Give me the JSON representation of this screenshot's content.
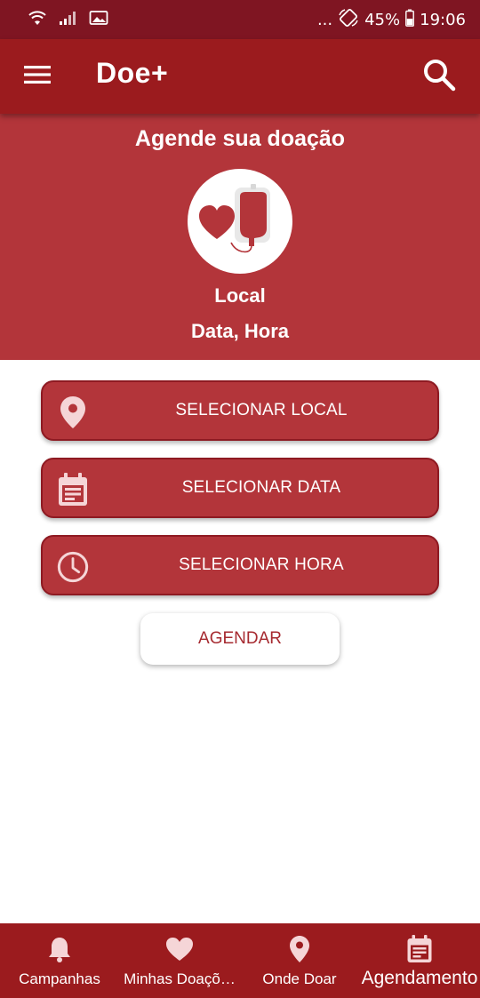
{
  "status_bar": {
    "dots": "...",
    "battery_percent": "45%",
    "time": "19:06"
  },
  "app_bar": {
    "title": "Doe+"
  },
  "hero": {
    "title": "Agende sua doação",
    "local": "Local",
    "datetime": "Data, Hora"
  },
  "actions": {
    "select_local": "SELECIONAR LOCAL",
    "select_date": "SELECIONAR DATA",
    "select_time": "SELECIONAR HORA",
    "schedule": "AGENDAR"
  },
  "bottom_nav": {
    "items": [
      {
        "label": "Campanhas",
        "icon": "bell-icon"
      },
      {
        "label": "Minhas Doaçõ…",
        "icon": "heart-icon"
      },
      {
        "label": "Onde Doar",
        "icon": "location-pin-icon"
      },
      {
        "label": "Agendamento",
        "icon": "calendar-icon",
        "active": true
      }
    ]
  },
  "colors": {
    "status_bar": "#7f1522",
    "app_bar": "#9b1b1e",
    "hero": "#b3353a",
    "button_border": "#8e1a22",
    "schedule_text": "#a62a30"
  }
}
